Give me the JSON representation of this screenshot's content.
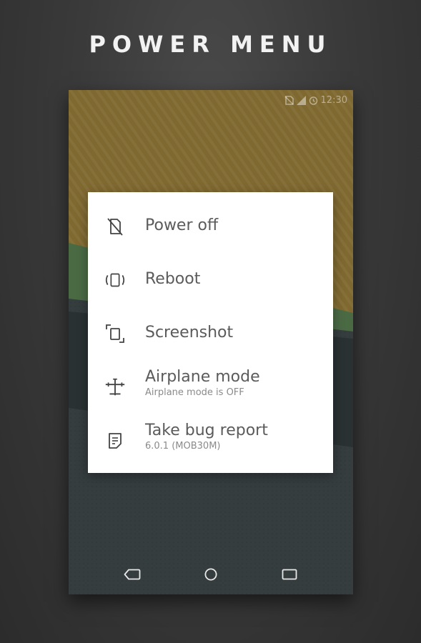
{
  "page": {
    "title": "POWER MENU"
  },
  "statusbar": {
    "time": "12:30",
    "icons": [
      "no-sim-icon",
      "signal-icon",
      "alarm-icon"
    ]
  },
  "wallpaper": {
    "colors": {
      "ochre": "#7f6930",
      "green": "#4a6a44",
      "dark_band": "#2b3233",
      "slate": "#363d3f"
    }
  },
  "power_menu": {
    "items": [
      {
        "icon": "power-off-icon",
        "label": "Power off",
        "sublabel": ""
      },
      {
        "icon": "reboot-icon",
        "label": "Reboot",
        "sublabel": ""
      },
      {
        "icon": "screenshot-icon",
        "label": "Screenshot",
        "sublabel": ""
      },
      {
        "icon": "airplane-icon",
        "label": "Airplane mode",
        "sublabel": "Airplane mode is OFF"
      },
      {
        "icon": "bug-report-icon",
        "label": "Take bug report",
        "sublabel": "6.0.1 (MOB30M)"
      }
    ]
  },
  "navbar": {
    "buttons": [
      "back-icon",
      "home-icon",
      "recents-icon"
    ]
  }
}
